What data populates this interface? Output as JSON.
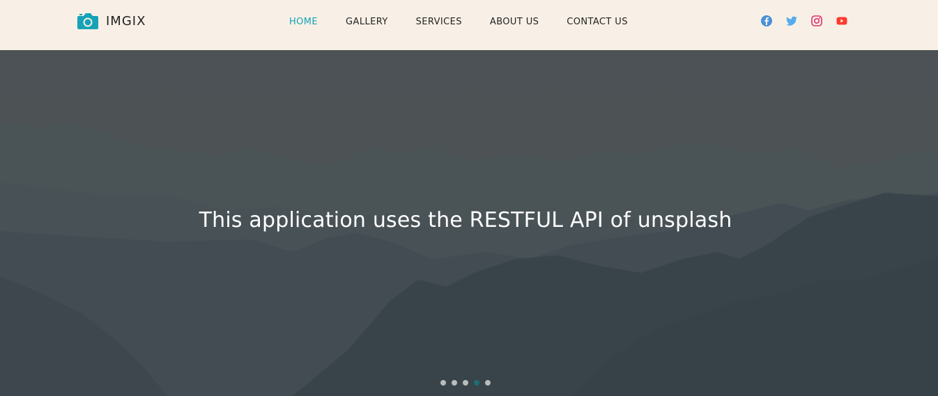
{
  "brand": {
    "name": "IMGIX",
    "logo_icon": "camera-icon",
    "accent": "#17a2b8"
  },
  "nav": {
    "items": [
      {
        "label": "HOME",
        "active": true
      },
      {
        "label": "GALLERY",
        "active": false
      },
      {
        "label": "SERVICES",
        "active": false
      },
      {
        "label": "ABOUT US",
        "active": false
      },
      {
        "label": "CONTACT US",
        "active": false
      }
    ]
  },
  "social": [
    {
      "icon": "facebook-icon",
      "color": "#4a90d9"
    },
    {
      "icon": "twitter-icon",
      "color": "#55acee"
    },
    {
      "icon": "instagram-icon",
      "color": "#e1306c"
    },
    {
      "icon": "youtube-icon",
      "color": "#ff3b30"
    }
  ],
  "hero": {
    "title": "This application uses the RESTFUL API of unsplash",
    "slides": 5,
    "active_slide": 4
  }
}
